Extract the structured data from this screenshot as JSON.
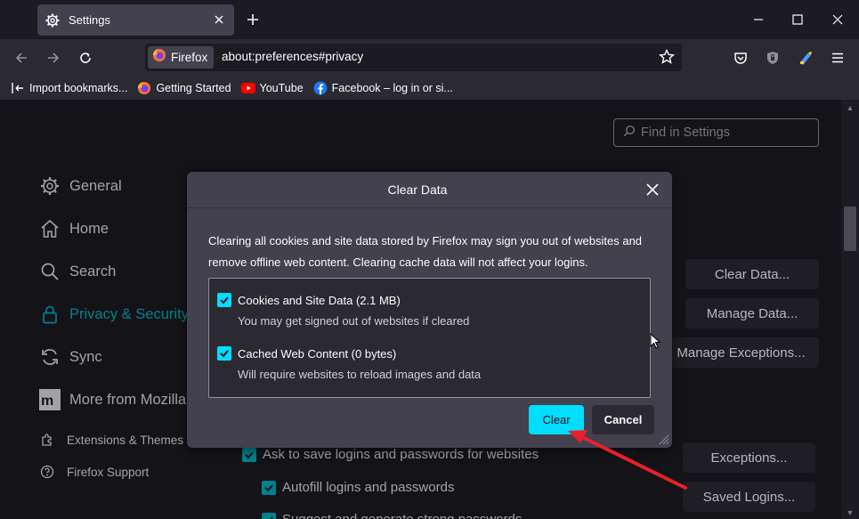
{
  "colors": {
    "accent": "#00b3c4",
    "dialog_accent": "#00ddff",
    "annotation_arrow": "#e8202a"
  },
  "tab": {
    "title": "Settings",
    "icon": "gear-icon"
  },
  "urlbar": {
    "identity_label": "Firefox",
    "url": "about:preferences#privacy"
  },
  "bookmarks": [
    {
      "label": "Import bookmarks...",
      "icon": "import-icon"
    },
    {
      "label": "Getting Started",
      "icon": "firefox-logo-icon"
    },
    {
      "label": "YouTube",
      "icon": "youtube-icon"
    },
    {
      "label": "Facebook – log in or si...",
      "icon": "facebook-icon"
    }
  ],
  "settings": {
    "search_placeholder": "Find in Settings",
    "categories": [
      {
        "label": "General",
        "icon": "gear-icon"
      },
      {
        "label": "Home",
        "icon": "home-icon"
      },
      {
        "label": "Search",
        "icon": "search-icon"
      },
      {
        "label": "Privacy & Security",
        "icon": "lock-icon"
      },
      {
        "label": "Sync",
        "icon": "sync-icon"
      },
      {
        "label": "More from Mozilla",
        "icon": "mozilla-icon"
      }
    ],
    "footer_links": [
      {
        "label": "Extensions & Themes",
        "icon": "puzzle-icon"
      },
      {
        "label": "Firefox Support",
        "icon": "help-icon"
      }
    ],
    "buttons": {
      "clear_data": "Clear Data...",
      "manage_data": "Manage Data...",
      "manage_exceptions": "Manage Exceptions...",
      "exceptions": "Exceptions...",
      "saved_logins": "Saved Logins..."
    },
    "checkboxes": [
      {
        "label": "Ask to save logins and passwords for websites",
        "checked": true
      },
      {
        "label": "Autofill logins and passwords",
        "checked": true
      },
      {
        "label": "Suggest and generate strong passwords",
        "checked": true
      }
    ]
  },
  "dialog": {
    "title": "Clear Data",
    "description": "Clearing all cookies and site data stored by Firefox may sign you out of websites and remove offline web content. Clearing cache data will not affect your logins.",
    "options": [
      {
        "label": "Cookies and Site Data (2.1 MB)",
        "sub": "You may get signed out of websites if cleared",
        "checked": true
      },
      {
        "label": "Cached Web Content (0 bytes)",
        "sub": "Will require websites to reload images and data",
        "checked": true
      }
    ],
    "clear_label": "Clear",
    "cancel_label": "Cancel"
  }
}
